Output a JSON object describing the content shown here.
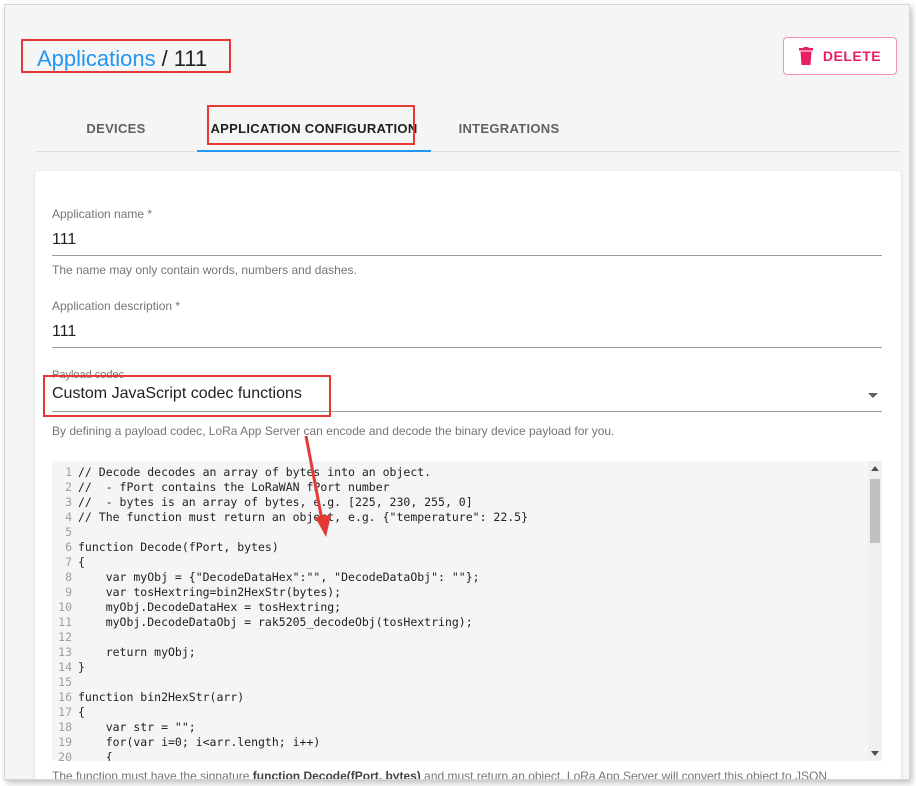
{
  "header": {
    "breadcrumb_link": "Applications",
    "breadcrumb_sep": "/",
    "breadcrumb_current": "111",
    "delete_label": "DELETE"
  },
  "tabs": [
    {
      "label": "DEVICES"
    },
    {
      "label": "APPLICATION CONFIGURATION"
    },
    {
      "label": "INTEGRATIONS"
    }
  ],
  "form": {
    "name_label": "Application name *",
    "name_value": "111",
    "name_helper": "The name may only contain words, numbers and dashes.",
    "desc_label": "Application description *",
    "desc_value": "111",
    "codec_label": "Payload codec",
    "codec_value": "Custom JavaScript codec functions",
    "codec_helper": "By defining a payload codec, LoRa App Server can encode and decode the binary device payload for you.",
    "footnote_pre": "The function must have the signature ",
    "footnote_sig": "function Decode(fPort, bytes)",
    "footnote_post": " and must return an object. LoRa App Server will convert this object to JSON."
  },
  "code": [
    {
      "n": "1",
      "t": "// Decode decodes an array of bytes into an object."
    },
    {
      "n": "2",
      "t": "//  - fPort contains the LoRaWAN fPort number"
    },
    {
      "n": "3",
      "t": "//  - bytes is an array of bytes, e.g. [225, 230, 255, 0]"
    },
    {
      "n": "4",
      "t": "// The function must return an object, e.g. {\"temperature\": 22.5}"
    },
    {
      "n": "5",
      "t": ""
    },
    {
      "n": "6",
      "t": "function Decode(fPort, bytes)"
    },
    {
      "n": "7",
      "t": "{"
    },
    {
      "n": "8",
      "t": "    var myObj = {\"DecodeDataHex\":\"\", \"DecodeDataObj\": \"\"};"
    },
    {
      "n": "9",
      "t": "    var tosHextring=bin2HexStr(bytes);"
    },
    {
      "n": "10",
      "t": "    myObj.DecodeDataHex = tosHextring;"
    },
    {
      "n": "11",
      "t": "    myObj.DecodeDataObj = rak5205_decodeObj(tosHextring);"
    },
    {
      "n": "12",
      "t": ""
    },
    {
      "n": "13",
      "t": "    return myObj;"
    },
    {
      "n": "14",
      "t": "}"
    },
    {
      "n": "15",
      "t": ""
    },
    {
      "n": "16",
      "t": "function bin2HexStr(arr)"
    },
    {
      "n": "17",
      "t": "{"
    },
    {
      "n": "18",
      "t": "    var str = \"\";"
    },
    {
      "n": "19",
      "t": "    for(var i=0; i<arr.length; i++)"
    },
    {
      "n": "20",
      "t": "    {"
    }
  ],
  "colors": {
    "accent": "#2196f3",
    "delete": "#e91e63",
    "highlight": "#e53935"
  },
  "icons": {
    "delete": "trash-icon",
    "dropdown": "caret-down-icon"
  }
}
